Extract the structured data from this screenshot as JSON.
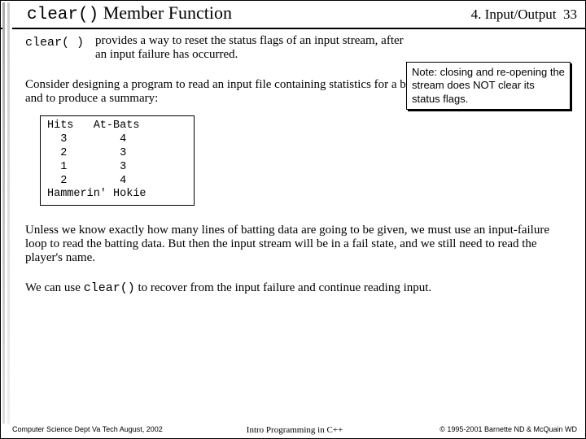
{
  "title_code": "clear()",
  "title_rest": " Member Function",
  "chapter": "4. Input/Output",
  "page_num": "33",
  "fn_name": "clear( )",
  "intro_desc": "provides a way to reset the status flags of an input stream, after an input failure has occurred.",
  "note": "Note:  closing and re-opening the stream does NOT clear its status flags.",
  "para1": "Consider designing a program to read an input file containing statistics for a baseball player, as shown below, and to produce a summary:",
  "data_block": "Hits   At-Bats\n  3        4\n  2        3\n  1        3\n  2        4\nHammerin' Hokie",
  "para2": "Unless we know exactly how many lines of batting data are going to be given, we must use an input-failure loop to read the batting data.  But then the input stream will be in a fail state, and we still need to read the player's name.",
  "para3_a": "We can use ",
  "para3_code": "clear()",
  "para3_b": " to recover from the input failure and continue reading input.",
  "footer_left": "Computer Science Dept Va Tech  August, 2002",
  "footer_center": "Intro Programming in C++",
  "footer_right": "© 1995-2001  Barnette ND & McQuain WD"
}
